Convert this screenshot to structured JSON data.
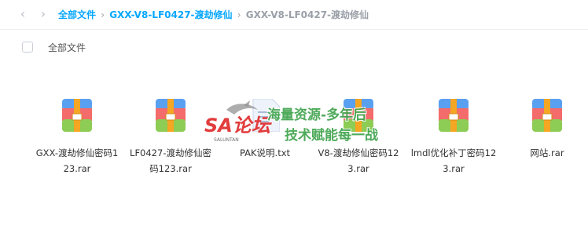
{
  "breadcrumb": {
    "root": "全部文件",
    "folder": "GXX-V8-LF0427-渡劫修仙",
    "current": "GXX-V8-LF0427-渡劫修仙",
    "separator": "›"
  },
  "toolbar": {
    "select_all_label": "全部文件"
  },
  "files": [
    {
      "name": "GXX-渡劫修仙密码123.rar",
      "icon": "rar-archive-icon"
    },
    {
      "name": "LF0427-渡劫修仙密码123.rar",
      "icon": "rar-archive-icon"
    },
    {
      "name": "PAK说明.txt",
      "icon": "text-file-icon"
    },
    {
      "name": "V8-渡劫修仙密码123.rar",
      "icon": "rar-archive-icon"
    },
    {
      "name": "lmdl优化补丁密码123.rar",
      "icon": "rar-archive-icon"
    },
    {
      "name": "网站.rar",
      "icon": "rar-archive-icon"
    }
  ],
  "watermark": {
    "logo_text": "SA论坛",
    "logo_sub": "SALUNTAN",
    "line1": "海量资源-多年后",
    "line2": "技术赋能每一战"
  },
  "colors": {
    "link": "#06a7ff",
    "muted": "#9aa0a8",
    "watermark": "#3fa34d"
  }
}
